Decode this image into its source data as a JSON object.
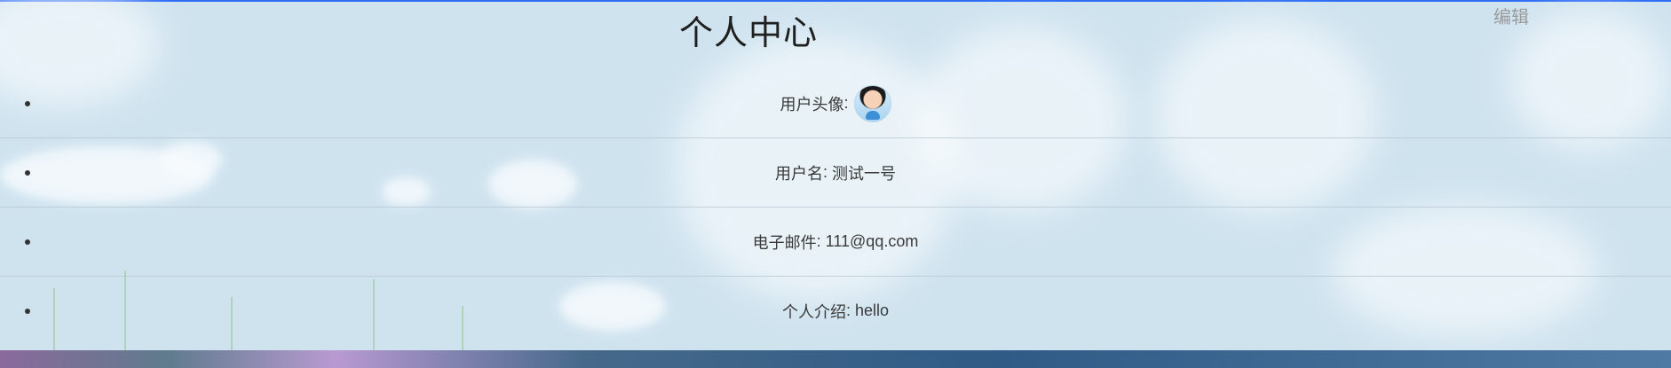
{
  "header": {
    "title": "个人中心",
    "edit_label": "编辑"
  },
  "profile": [
    {
      "label": "用户头像",
      "value": ""
    },
    {
      "label": "用户名",
      "value": "测试一号"
    },
    {
      "label": "电子邮件",
      "value": "111@qq.com"
    },
    {
      "label": "个人介绍",
      "value": "hello"
    }
  ],
  "colors": {
    "accent": "#2f6df6",
    "edit": "#9a9a9a"
  }
}
